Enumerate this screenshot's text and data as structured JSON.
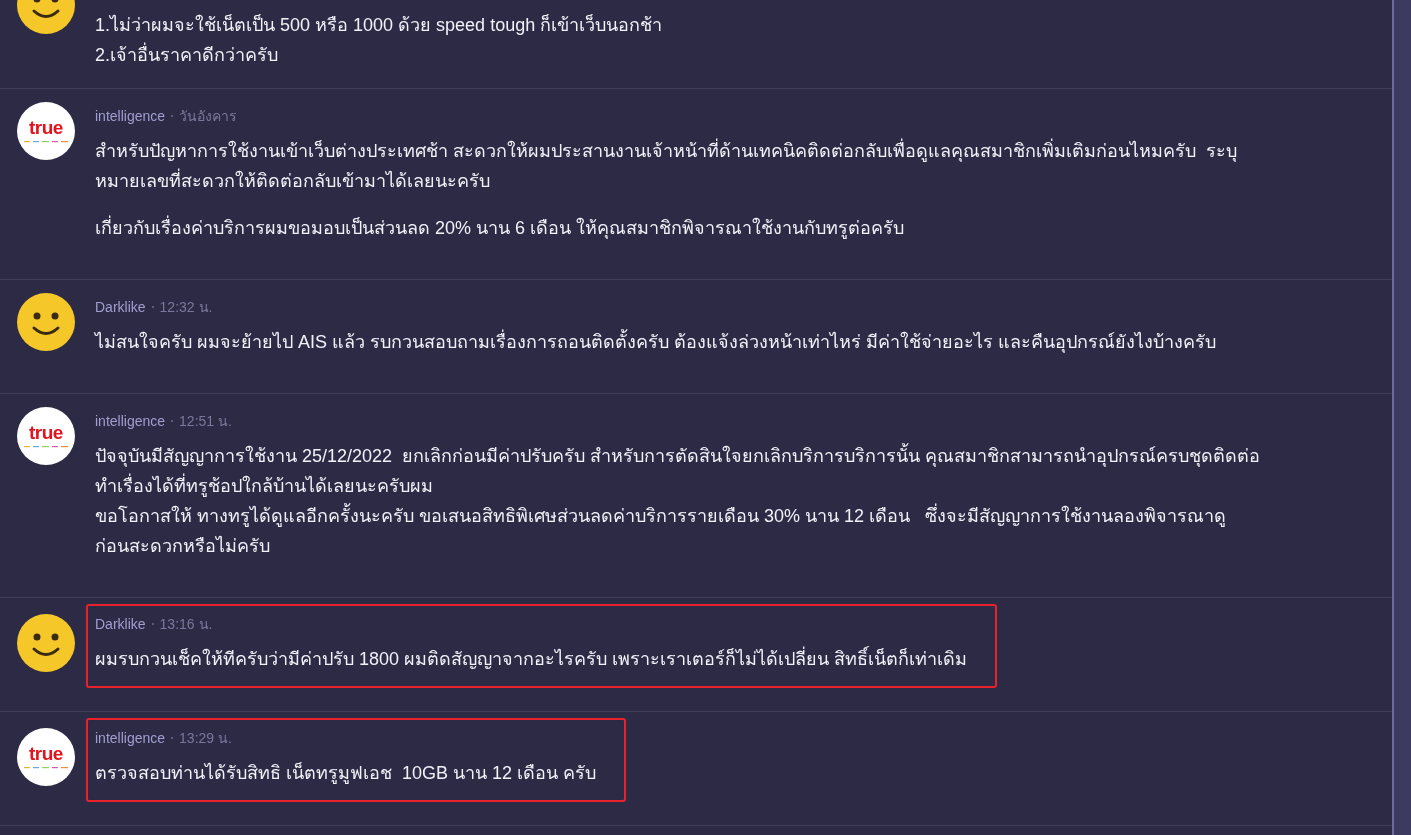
{
  "posts": [
    {
      "avatar": {
        "kind": "smiley"
      },
      "highlighted": false,
      "paragraphs": [
        "1.ไม่ว่าผมจะใช้เน็ตเป็น 500 หรือ 1000 ด้วย speed tough ก็เข้าเว็บนอกช้า\n2.เจ้าอื่นราคาดีกว่าครับ"
      ]
    },
    {
      "avatar": {
        "kind": "brand",
        "text": "true"
      },
      "author": "intelligence",
      "time": "วันอังคาร",
      "highlighted": false,
      "paragraphs": [
        "สำหรับปัญหาการใช้งานเข้าเว็บต่างประเทศช้า สะดวกให้ผมประสานงานเจ้าหน้าที่ด้านเทคนิคติดต่อกลับเพื่อดูแลคุณสมาชิกเพิ่มเติมก่อนไหมครับ  ระบุ\nหมายเลขที่สะดวกให้ติดต่อกลับเข้ามาได้เลยนะครับ",
        "เกี่ยวกับเรื่องค่าบริการผมขอมอบเป็นส่วนลด 20% นาน 6 เดือน ให้คุณสมาชิกพิจารณาใช้งานกับทรูต่อครับ"
      ]
    },
    {
      "avatar": {
        "kind": "smiley"
      },
      "author": "Darklike",
      "time": "12:32 น.",
      "highlighted": false,
      "paragraphs": [
        "ไม่สนใจครับ ผมจะย้ายไป AIS แล้ว รบกวนสอบถามเรื่องการถอนติดตั้งครับ ต้องแจ้งล่วงหน้าเท่าไหร่ มีค่าใช้จ่ายอะไร และคืนอุปกรณ์ยังไงบ้างครับ"
      ]
    },
    {
      "avatar": {
        "kind": "brand",
        "text": "true"
      },
      "author": "intelligence",
      "time": "12:51 น.",
      "highlighted": false,
      "paragraphs": [
        "ปัจจุบันมีสัญญาการใช้งาน 25/12/2022  ยกเลิกก่อนมีค่าปรับครับ สำหรับการตัดสินใจยกเลิกบริการบริการนั้น คุณสมาชิกสามารถนำอุปกรณ์ครบชุดติดต่อ\nทำเรื่องได้ที่ทรูช้อปใกล้บ้านได้เลยนะครับผม\nขอโอกาสให้ ทางทรูได้ดูแลอีกครั้งนะครับ ขอเสนอสิทธิพิเศษส่วนลดค่าบริการรายเดือน 30% นาน 12 เดือน   ซึ่งจะมีสัญญาการใช้งานลองพิจารณาดู\nก่อนสะดวกหรือไม่ครับ"
      ]
    },
    {
      "avatar": {
        "kind": "smiley"
      },
      "author": "Darklike",
      "time": "13:16 น.",
      "highlighted": true,
      "paragraphs": [
        "ผมรบกวนเช็คให้ทีครับว่ามีค่าปรับ 1800 ผมติดสัญญาจากอะไรครับ เพราะเราเตอร์ก็ไม่ได้เปลี่ยน สิทธิ์เน็ตก็เท่าเดิม"
      ]
    },
    {
      "avatar": {
        "kind": "brand",
        "text": "true"
      },
      "author": "intelligence",
      "time": "13:29 น.",
      "highlighted": true,
      "paragraphs": [
        "ตรวจสอบท่านได้รับสิทธิ เน็ตทรูมูฟเอช  10GB นาน 12 เดือน ครับ"
      ]
    }
  ]
}
